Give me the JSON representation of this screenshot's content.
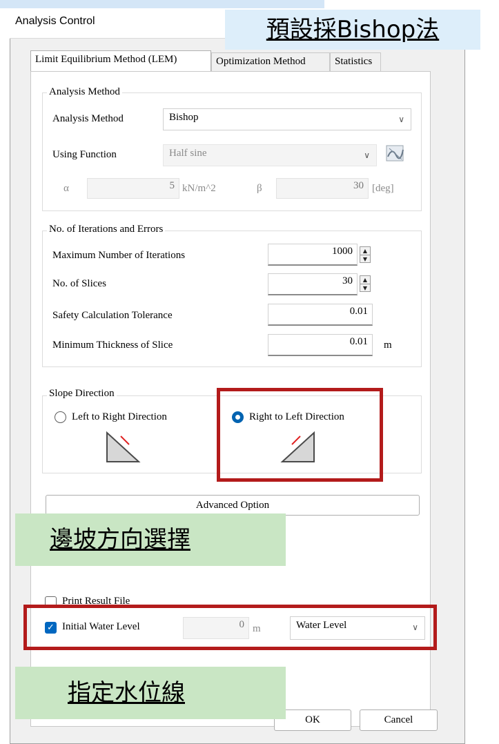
{
  "window": {
    "title": "Analysis Control"
  },
  "tabs": [
    {
      "label": "Limit Equilibrium Method (LEM)",
      "active": true
    },
    {
      "label": "Optimization Method",
      "active": false
    },
    {
      "label": "Statistics",
      "active": false
    }
  ],
  "analysis_method_group": {
    "title": "Analysis Method",
    "method_label": "Analysis Method",
    "method_value": "Bishop",
    "function_label": "Using Function",
    "function_value": "Half sine",
    "alpha_symbol": "α",
    "alpha_value": "5",
    "alpha_unit": "kN/m^2",
    "beta_symbol": "β",
    "beta_value": "30",
    "beta_unit": "[deg]"
  },
  "iterations_group": {
    "title": "No. of Iterations and Errors",
    "max_iter_label": "Maximum Number of Iterations",
    "max_iter_value": "1000",
    "slices_label": "No. of Slices",
    "slices_value": "30",
    "tolerance_label": "Safety Calculation Tolerance",
    "tolerance_value": "0.01",
    "min_thickness_label": "Minimum Thickness of Slice",
    "min_thickness_value": "0.01",
    "min_thickness_unit": "m"
  },
  "slope_direction_group": {
    "title": "Slope Direction",
    "left_to_right_label": "Left to Right Direction",
    "right_to_left_label": "Right to Left Direction",
    "selected": "right_to_left"
  },
  "advanced_option_label": "Advanced Option",
  "print_result": {
    "label": "Print Result File",
    "checked": false
  },
  "water": {
    "checkbox_label": "Initial Water Level",
    "checked": true,
    "value": "0",
    "unit": "m",
    "select_value": "Water Level"
  },
  "buttons": {
    "ok": "OK",
    "cancel": "Cancel"
  },
  "annotations": {
    "default_bishop": "預設採Bishop法",
    "slope_direction_choice": "邊坡方向選擇",
    "water_level_assign": "指定水位線"
  },
  "colors": {
    "highlight_red": "#b31b1b",
    "note_green": "#c9e6c4",
    "radio_blue": "#0063b1"
  }
}
